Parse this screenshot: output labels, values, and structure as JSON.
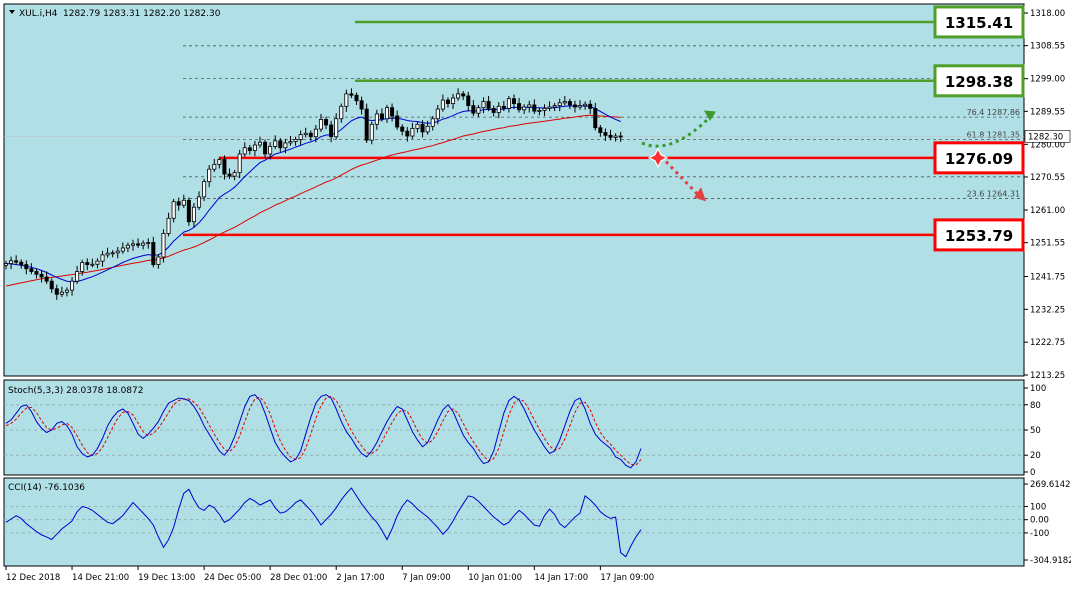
{
  "colors": {
    "background": "#ffffff",
    "plot_bg": "#b0e0e6",
    "grid": "#9ab6ba",
    "candle": "#000000",
    "ma_fast": "#0000cd",
    "ma_slow": "#e00000",
    "resistance": "#4f9e2a",
    "support": "#ff0000",
    "fib": "#555555",
    "stoch_main": "#0000cd",
    "stoch_signal": "#e00000",
    "cci": "#0000cd"
  },
  "header": {
    "symbol": "XUL.i,H4",
    "ohlc": "1282.79 1283.31 1282.20 1282.30"
  },
  "chart_data": [
    {
      "type": "candlestick",
      "title": "XUL.i,H4",
      "ylim": [
        1213.25,
        1318.0
      ],
      "y_ticks": [
        "1318.00",
        "1308.55",
        "1299.00",
        "1289.55",
        "1280.00",
        "1270.55",
        "1261.00",
        "1251.55",
        "1241.75",
        "1232.25",
        "1222.75",
        "1213.25"
      ],
      "x_ticks": [
        "12 Dec 2018",
        "14 Dec 21:00",
        "19 Dec 13:00",
        "24 Dec 05:00",
        "28 Dec 01:00",
        "2 Jan 17:00",
        "7 Jan 09:00",
        "10 Jan 01:00",
        "14 Jan 17:00",
        "17 Jan 09:00"
      ],
      "x_tick_index": [
        0,
        13,
        26,
        39,
        52,
        65,
        78,
        91,
        104,
        117
      ],
      "current_price": "1282.30",
      "close": [
        1245.5,
        1246.3,
        1245.9,
        1245.2,
        1244.0,
        1243.2,
        1242.4,
        1241.6,
        1240.4,
        1238.2,
        1236.6,
        1237.2,
        1237.8,
        1240.4,
        1243.2,
        1245.8,
        1245.2,
        1245.3,
        1246.2,
        1248.0,
        1248.5,
        1248.6,
        1249.1,
        1250.0,
        1250.8,
        1251.2,
        1250.8,
        1251.4,
        1251.6,
        1245.2,
        1247.4,
        1254.2,
        1258.6,
        1263.4,
        1262.4,
        1263.8,
        1257.6,
        1261.8,
        1264.8,
        1269.2,
        1272.8,
        1274.2,
        1275.6,
        1271.4,
        1270.8,
        1271.8,
        1277.2,
        1279.0,
        1278.2,
        1279.8,
        1280.6,
        1277.2,
        1279.4,
        1281.0,
        1279.0,
        1280.4,
        1280.8,
        1281.4,
        1282.8,
        1283.2,
        1282.2,
        1284.4,
        1287.2,
        1285.6,
        1282.2,
        1287.4,
        1291.0,
        1294.6,
        1294.2,
        1292.6,
        1290.2,
        1281.2,
        1285.8,
        1288.8,
        1287.4,
        1290.6,
        1288.2,
        1285.0,
        1283.8,
        1282.4,
        1284.6,
        1285.8,
        1283.6,
        1285.2,
        1287.4,
        1290.2,
        1292.8,
        1291.8,
        1293.4,
        1294.6,
        1294.0,
        1291.2,
        1289.0,
        1290.6,
        1292.4,
        1290.4,
        1289.2,
        1291.0,
        1290.4,
        1293.2,
        1291.8,
        1290.0,
        1290.8,
        1291.4,
        1289.6,
        1289.8,
        1290.4,
        1290.8,
        1291.2,
        1292.0,
        1292.4,
        1291.4,
        1290.8,
        1291.2,
        1291.6,
        1290.4,
        1284.8,
        1283.4,
        1282.6,
        1282.0,
        1282.4,
        1282.3
      ],
      "ma_fast": {
        "name": "",
        "values": [
          1245.5,
          1245.4,
          1245.2,
          1245.0,
          1244.7,
          1244.4,
          1244.0,
          1243.5,
          1242.9,
          1242.2,
          1241.5,
          1240.9,
          1240.4,
          1240.2,
          1240.3,
          1240.7,
          1241.2,
          1241.7,
          1242.3,
          1243.0,
          1243.7,
          1244.4,
          1245.1,
          1245.8,
          1246.4,
          1247.0,
          1247.4,
          1247.8,
          1248.1,
          1247.9,
          1248.0,
          1248.9,
          1250.3,
          1252.0,
          1253.3,
          1254.6,
          1255.1,
          1256.0,
          1257.3,
          1259.0,
          1261.0,
          1262.8,
          1264.6,
          1265.6,
          1266.5,
          1267.6,
          1269.1,
          1270.7,
          1272.0,
          1273.4,
          1274.7,
          1275.4,
          1276.3,
          1277.2,
          1277.6,
          1278.1,
          1278.6,
          1279.2,
          1279.7,
          1280.3,
          1280.7,
          1281.3,
          1282.2,
          1282.7,
          1282.7,
          1283.3,
          1284.3,
          1285.6,
          1286.8,
          1287.5,
          1287.9,
          1287.1,
          1286.9,
          1287.0,
          1287.1,
          1287.5,
          1287.6,
          1287.5,
          1287.3,
          1286.9,
          1286.7,
          1286.6,
          1286.3,
          1286.1,
          1286.2,
          1286.6,
          1287.3,
          1287.7,
          1288.3,
          1289.0,
          1289.5,
          1289.7,
          1289.6,
          1289.7,
          1290.0,
          1290.1,
          1290.0,
          1290.1,
          1290.2,
          1290.5,
          1290.7,
          1290.6,
          1290.6,
          1290.7,
          1290.6,
          1290.6,
          1290.5,
          1290.5,
          1290.6,
          1290.8,
          1291.0,
          1291.1,
          1291.1,
          1291.1,
          1291.1,
          1291.0,
          1290.3,
          1289.5,
          1288.7,
          1287.9,
          1287.2,
          1286.6
        ]
      },
      "ma_slow": {
        "name": "",
        "values": [
          1239.0,
          1239.3,
          1239.6,
          1239.9,
          1240.2,
          1240.5,
          1240.8,
          1241.1,
          1241.3,
          1241.5,
          1241.7,
          1241.9,
          1242.1,
          1242.3,
          1242.5,
          1242.8,
          1243.0,
          1243.3,
          1243.5,
          1243.8,
          1244.1,
          1244.4,
          1244.7,
          1245.0,
          1245.3,
          1245.6,
          1245.8,
          1246.1,
          1246.4,
          1246.5,
          1246.7,
          1247.1,
          1247.6,
          1248.2,
          1248.8,
          1249.4,
          1249.8,
          1250.3,
          1250.9,
          1251.6,
          1252.3,
          1253.1,
          1253.9,
          1254.6,
          1255.3,
          1256.0,
          1256.8,
          1257.7,
          1258.5,
          1259.3,
          1260.2,
          1260.9,
          1261.6,
          1262.4,
          1263.0,
          1263.7,
          1264.4,
          1265.0,
          1265.7,
          1266.4,
          1267.0,
          1267.7,
          1268.4,
          1269.1,
          1269.6,
          1270.3,
          1271.1,
          1271.9,
          1272.7,
          1273.4,
          1274.0,
          1274.4,
          1274.9,
          1275.4,
          1275.9,
          1276.5,
          1276.9,
          1277.3,
          1277.6,
          1277.9,
          1278.3,
          1278.6,
          1278.9,
          1279.3,
          1279.6,
          1280.1,
          1280.5,
          1281.0,
          1281.4,
          1281.9,
          1282.4,
          1282.7,
          1283.0,
          1283.4,
          1283.7,
          1284.0,
          1284.3,
          1284.6,
          1284.8,
          1285.2,
          1285.4,
          1285.6,
          1285.9,
          1286.1,
          1286.3,
          1286.5,
          1286.7,
          1286.9,
          1287.1,
          1287.3,
          1287.6,
          1287.7,
          1287.9,
          1288.1,
          1288.3,
          1288.4,
          1288.3,
          1288.2,
          1288.1,
          1288.0,
          1287.9,
          1287.8
        ]
      }
    },
    {
      "type": "line",
      "title": "Stoch(5,3,3) 28.0378 18.0872",
      "ylim": [
        0,
        100
      ],
      "y_ticks": [
        "100",
        "80",
        "50",
        "20",
        "0"
      ],
      "series": [
        {
          "name": "",
          "values": [
            58,
            62,
            70,
            78,
            80,
            72,
            60,
            52,
            47,
            50,
            58,
            60,
            55,
            45,
            30,
            22,
            18,
            20,
            28,
            40,
            55,
            65,
            72,
            75,
            70,
            58,
            45,
            40,
            45,
            52,
            60,
            72,
            82,
            85,
            88,
            87,
            85,
            78,
            68,
            55,
            45,
            35,
            25,
            20,
            28,
            42,
            60,
            78,
            90,
            92,
            85,
            70,
            52,
            35,
            25,
            18,
            12,
            15,
            25,
            45,
            65,
            82,
            90,
            92,
            88,
            75,
            60,
            48,
            40,
            30,
            22,
            18,
            25,
            35,
            48,
            60,
            70,
            78,
            75,
            62,
            48,
            38,
            30,
            35,
            48,
            62,
            74,
            80,
            72,
            58,
            44,
            35,
            28,
            18,
            10,
            12,
            25,
            48,
            70,
            85,
            90,
            86,
            75,
            62,
            50,
            40,
            30,
            22,
            25,
            38,
            55,
            72,
            85,
            88,
            75,
            58,
            45,
            38,
            33,
            28,
            18,
            15,
            8,
            5,
            12,
            28
          ]
        },
        {
          "name": "",
          "values": [
            55,
            58,
            63,
            70,
            76,
            77,
            71,
            61,
            53,
            50,
            52,
            56,
            58,
            53,
            43,
            32,
            23,
            20,
            22,
            29,
            41,
            53,
            64,
            71,
            72,
            68,
            58,
            48,
            43,
            46,
            52,
            61,
            71,
            80,
            85,
            87,
            87,
            83,
            77,
            67,
            56,
            45,
            35,
            27,
            24,
            30,
            43,
            60,
            76,
            87,
            89,
            82,
            69,
            52,
            37,
            26,
            18,
            15,
            17,
            28,
            45,
            64,
            79,
            88,
            90,
            85,
            74,
            61,
            49,
            39,
            31,
            23,
            22,
            26,
            36,
            48,
            59,
            69,
            74,
            72,
            62,
            49,
            39,
            34,
            38,
            48,
            61,
            72,
            75,
            70,
            58,
            46,
            36,
            27,
            19,
            13,
            16,
            28,
            48,
            68,
            82,
            87,
            84,
            74,
            62,
            51,
            40,
            31,
            26,
            28,
            39,
            55,
            71,
            82,
            83,
            74,
            59,
            47,
            39,
            33,
            26,
            20,
            14,
            9,
            8,
            15
          ]
        }
      ]
    },
    {
      "type": "line",
      "title": "CCI(14) -76.1036",
      "ylim": [
        -305,
        270
      ],
      "y_ticks": [
        "269.6142",
        "100",
        "0.00",
        "-100",
        "-304.9182"
      ],
      "series": [
        {
          "name": "",
          "values": [
            -20,
            5,
            30,
            10,
            -30,
            -60,
            -90,
            -115,
            -130,
            -150,
            -110,
            -70,
            -40,
            -10,
            60,
            100,
            90,
            70,
            40,
            10,
            -20,
            -30,
            0,
            30,
            80,
            130,
            90,
            50,
            10,
            -40,
            -130,
            -210,
            -150,
            -60,
            80,
            200,
            230,
            150,
            90,
            70,
            110,
            90,
            40,
            -20,
            0,
            40,
            80,
            130,
            160,
            140,
            110,
            130,
            150,
            90,
            50,
            60,
            90,
            130,
            150,
            110,
            70,
            20,
            -40,
            0,
            40,
            90,
            150,
            200,
            240,
            180,
            120,
            70,
            20,
            -20,
            -80,
            -150,
            -70,
            30,
            100,
            150,
            120,
            80,
            50,
            20,
            -20,
            -60,
            -110,
            -70,
            -10,
            60,
            120,
            180,
            170,
            140,
            100,
            60,
            20,
            -10,
            -40,
            -20,
            30,
            70,
            40,
            0,
            -40,
            -50,
            30,
            80,
            40,
            -30,
            -60,
            -20,
            20,
            50,
            180,
            150,
            110,
            60,
            30,
            10,
            20,
            -250,
            -280,
            -200,
            -130,
            -76
          ]
        }
      ]
    }
  ],
  "levels": [
    {
      "name": "resistance-upper",
      "value": 1315.41,
      "label": "1315.41",
      "kind": "resistance"
    },
    {
      "name": "resistance",
      "value": 1298.38,
      "label": "1298.38",
      "kind": "resistance"
    },
    {
      "name": "support",
      "value": 1276.09,
      "label": "1276.09",
      "kind": "support"
    },
    {
      "name": "support-lower",
      "value": 1253.79,
      "label": "1253.79",
      "kind": "support"
    }
  ],
  "fibonacci": [
    {
      "level": "76.4",
      "price": 1287.86,
      "label": "76.4 1287.86"
    },
    {
      "level": "61.8",
      "price": 1281.35,
      "label": "61.8 1281.35"
    },
    {
      "level": "23.6",
      "price": 1264.31,
      "label": "23.6 1264.31"
    }
  ],
  "fib_extra_prices": [
    1308.5,
    1270.6
  ]
}
